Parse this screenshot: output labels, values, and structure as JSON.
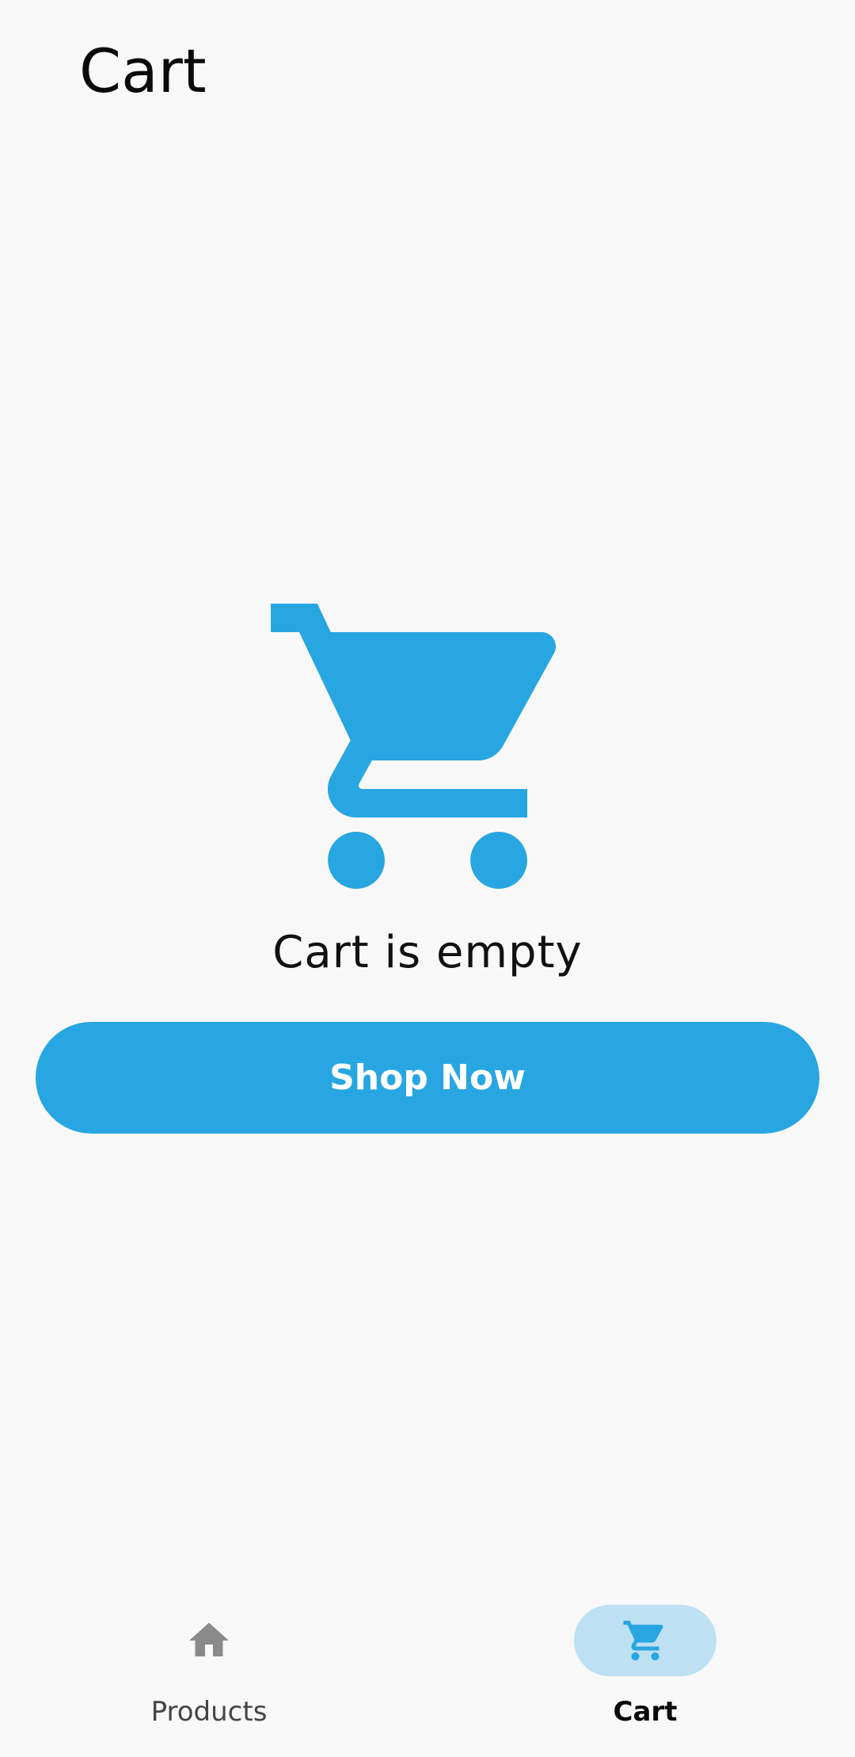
{
  "header": {
    "title": "Cart"
  },
  "empty_state": {
    "icon": "shopping-cart-icon",
    "message": "Cart is empty",
    "button_label": "Shop Now"
  },
  "bottom_nav": {
    "items": [
      {
        "label": "Products",
        "icon": "home-icon",
        "selected": false
      },
      {
        "label": "Cart",
        "icon": "shopping-cart-icon",
        "selected": true
      }
    ]
  },
  "colors": {
    "background": "#f8f8f8",
    "accent": "#27a6e2",
    "nav_active_pill": "#bde0f2",
    "nav_inactive_icon": "#8a8a8a"
  }
}
